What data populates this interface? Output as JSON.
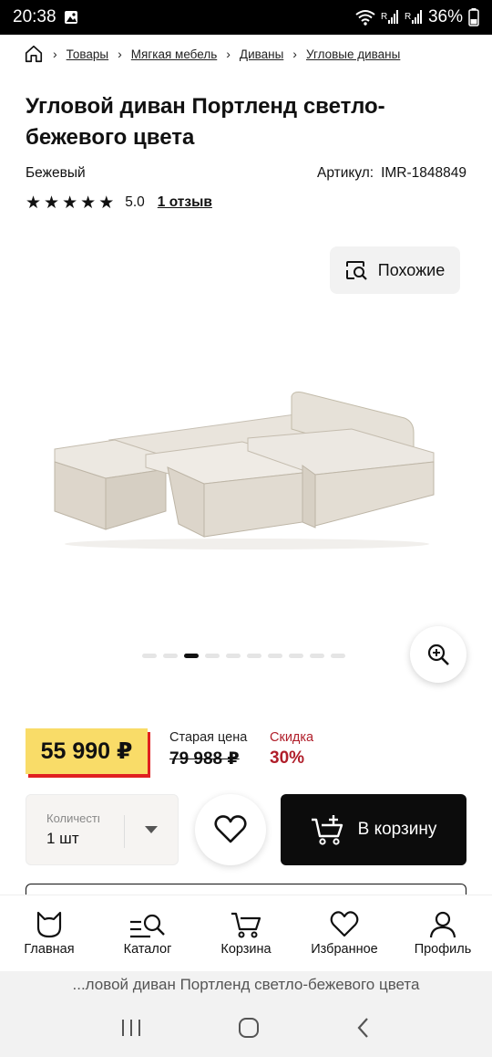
{
  "status_bar": {
    "time": "20:38",
    "battery": "36%",
    "sim1": "R",
    "sim2": "R"
  },
  "breadcrumb": [
    "Товары",
    "Мягкая мебель",
    "Диваны",
    "Угловые диваны"
  ],
  "product": {
    "title": "Угловой диван Портленд светло-бежевого цвета",
    "color": "Бежевый",
    "article_label": "Артикул:",
    "article_value": "IMR-1848849",
    "rating": "5.0",
    "stars": 5,
    "reviews": "1 отзыв"
  },
  "gallery": {
    "similar_label": "Похожие",
    "dots": 10,
    "active_dot": 2
  },
  "price": {
    "current": "55 990 ₽",
    "old_label": "Старая цена",
    "old": "79 988 ₽",
    "discount_label": "Скидка",
    "discount": "30%"
  },
  "quantity": {
    "label": "Количество",
    "value": "1 шт"
  },
  "cart_button": "В корзину",
  "bottom_nav": [
    {
      "label": "Главная",
      "icon": "cat-icon"
    },
    {
      "label": "Каталог",
      "icon": "catalog-search-icon"
    },
    {
      "label": "Корзина",
      "icon": "cart-icon"
    },
    {
      "label": "Избранное",
      "icon": "heart-icon"
    },
    {
      "label": "Профиль",
      "icon": "profile-icon"
    }
  ],
  "url_bar": "...ловой диван Портленд светло-бежевого цвета",
  "colors": {
    "price_tag": "#f9dc68",
    "price_shadow": "#e02020",
    "discount": "#b01e2a",
    "cart_button": "#0c0c0c"
  }
}
